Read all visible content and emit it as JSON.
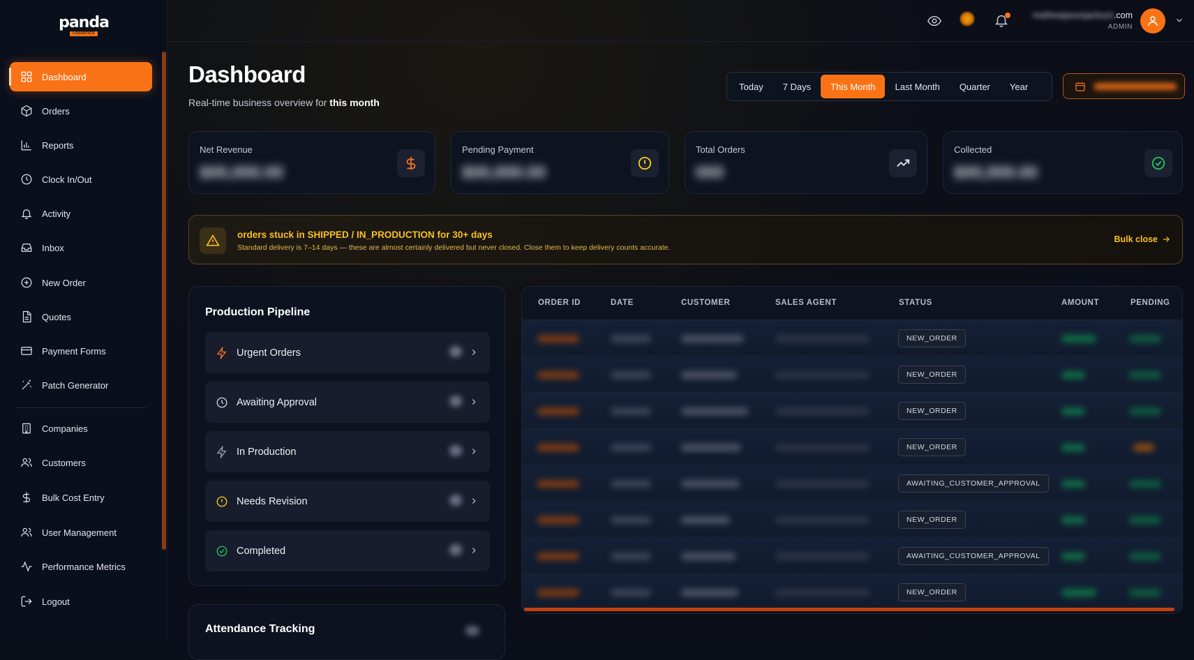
{
  "brand": {
    "logo_word": "panda",
    "logo_tag": "LOGISTICS"
  },
  "sidebar": {
    "items": [
      {
        "label": "Dashboard",
        "icon": "grid-icon",
        "active": true
      },
      {
        "label": "Orders",
        "icon": "package-icon"
      },
      {
        "label": "Reports",
        "icon": "bar-chart-icon"
      },
      {
        "label": "Clock In/Out",
        "icon": "clock-icon"
      },
      {
        "label": "Activity",
        "icon": "bell-icon"
      },
      {
        "label": "Inbox",
        "icon": "inbox-icon"
      },
      {
        "label": "New Order",
        "icon": "plus-circle-icon"
      },
      {
        "label": "Quotes",
        "icon": "file-text-icon"
      },
      {
        "label": "Payment Forms",
        "icon": "credit-card-icon"
      },
      {
        "label": "Patch Generator",
        "icon": "wand-icon"
      },
      {
        "label": "Companies",
        "icon": "building-icon"
      },
      {
        "label": "Customers",
        "icon": "users-icon"
      },
      {
        "label": "Bulk Cost Entry",
        "icon": "dollar-icon"
      },
      {
        "label": "User Management",
        "icon": "user-cog-icon"
      },
      {
        "label": "Performance Metrics",
        "icon": "activity-icon"
      },
      {
        "label": "Logout",
        "icon": "logout-icon"
      }
    ]
  },
  "header": {
    "user_email_suffix": ".com",
    "user_role": "ADMIN"
  },
  "page": {
    "title": "Dashboard",
    "subtitle_prefix": "Real-time business overview for ",
    "subtitle_bold": "this month"
  },
  "range": {
    "options": [
      "Today",
      "7 Days",
      "This Month",
      "Last Month",
      "Quarter",
      "Year"
    ],
    "selected": "This Month"
  },
  "stats": [
    {
      "label": "Net Revenue",
      "value": "$00,000.00",
      "icon": "dollar-icon",
      "color": "#f97316"
    },
    {
      "label": "Pending Payment",
      "value": "$00,000.00",
      "icon": "alert-circle-icon",
      "color": "#facc15"
    },
    {
      "label": "Total Orders",
      "value": "000",
      "icon": "trending-up-icon",
      "color": "#e5e7eb"
    },
    {
      "label": "Collected",
      "value": "$00,000.00",
      "icon": "check-circle-icon",
      "color": "#22c55e"
    }
  ],
  "alert": {
    "title": "orders stuck in SHIPPED / IN_PRODUCTION for 30+ days",
    "description": "Standard delivery is 7–14 days — these are almost certainly delivered but never closed. Close them to keep delivery counts accurate.",
    "action": "Bulk close"
  },
  "pipeline": {
    "title": "Production Pipeline",
    "items": [
      {
        "label": "Urgent Orders",
        "icon": "zap-icon",
        "icon_color": "#f97316"
      },
      {
        "label": "Awaiting Approval",
        "icon": "clock-icon",
        "icon_color": "#d1d5db"
      },
      {
        "label": "In Production",
        "icon": "zap-icon",
        "icon_color": "#9ca3af"
      },
      {
        "label": "Needs Revision",
        "icon": "alert-circle-icon",
        "icon_color": "#facc15"
      },
      {
        "label": "Completed",
        "icon": "check-circle-icon",
        "icon_color": "#22c55e"
      }
    ]
  },
  "attendance": {
    "title": "Attendance Tracking"
  },
  "orders_table": {
    "columns": [
      "ORDER ID",
      "DATE",
      "CUSTOMER",
      "SALES AGENT",
      "STATUS",
      "AMOUNT",
      "PENDING"
    ],
    "rows": [
      {
        "status": "NEW_ORDER"
      },
      {
        "status": "NEW_ORDER"
      },
      {
        "status": "NEW_ORDER"
      },
      {
        "status": "NEW_ORDER"
      },
      {
        "status": "AWAITING_CUSTOMER_APPROVAL"
      },
      {
        "status": "NEW_ORDER"
      },
      {
        "status": "AWAITING_CUSTOMER_APPROVAL"
      },
      {
        "status": "NEW_ORDER"
      }
    ]
  },
  "colors": {
    "accent": "#f97316",
    "warning": "#fbbf24",
    "success": "#22c55e",
    "background": "#0b0f1a"
  }
}
